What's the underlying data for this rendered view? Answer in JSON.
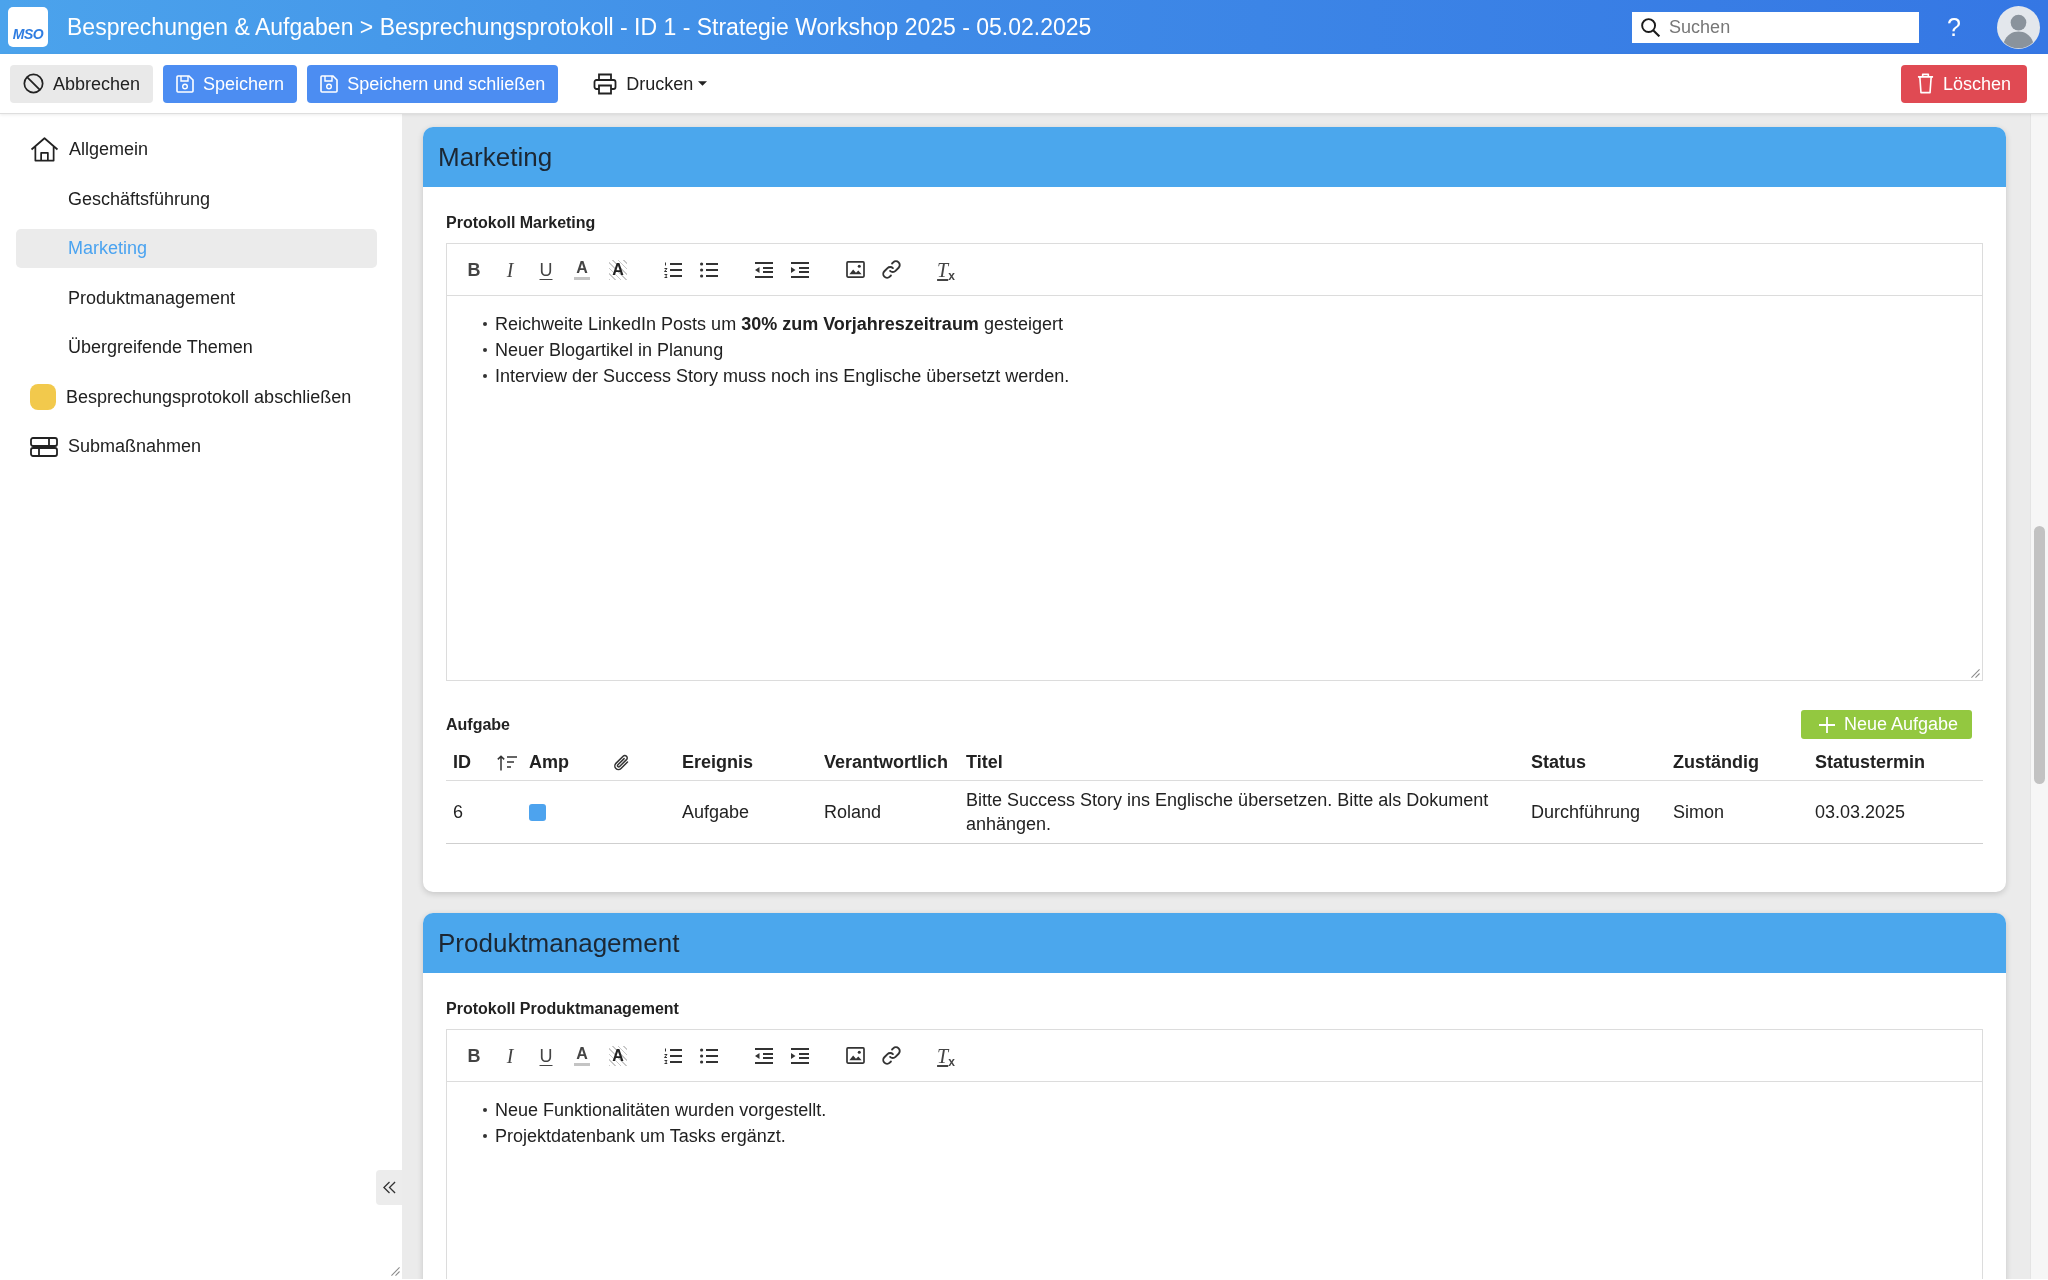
{
  "topbar": {
    "logo": "MSO",
    "title": "Besprechungen & Aufgaben > Besprechungsprotokoll - ID 1 - Strategie Workshop 2025 - 05.02.2025",
    "search": {
      "placeholder": "Suchen"
    },
    "help": "?"
  },
  "actions": [
    {
      "kind": "cancel",
      "label": "Abbrechen",
      "dropdown": false
    },
    {
      "kind": "save",
      "label": "Speichern",
      "dropdown": false
    },
    {
      "kind": "save_close",
      "label": "Speichern und schließen",
      "dropdown": false
    },
    {
      "kind": "print",
      "label": "Drucken",
      "dropdown": true
    }
  ],
  "delete_button": {
    "label": "Löschen"
  },
  "sidebar": {
    "items": [
      {
        "kind": "home",
        "label": "Allgemein",
        "selected": false
      },
      {
        "kind": "section",
        "label": "Geschäftsführung",
        "selected": false
      },
      {
        "kind": "section",
        "label": "Marketing",
        "selected": true
      },
      {
        "kind": "section",
        "label": "Produktmanagement",
        "selected": false
      },
      {
        "kind": "section",
        "label": "Übergreifende Themen",
        "selected": false
      },
      {
        "kind": "status",
        "label": "Besprechungsprotokoll abschließen",
        "color": "#f2c94c",
        "selected": false
      },
      {
        "kind": "table",
        "label": "Submaßnahmen",
        "selected": false
      }
    ]
  },
  "sections": [
    {
      "title": "Marketing",
      "editor": {
        "label": "Protokoll Marketing",
        "toolbar": [
          [
            {
              "kind": "bold",
              "glyph": "B"
            },
            {
              "kind": "italic",
              "glyph": "I"
            },
            {
              "kind": "underline",
              "glyph": "U"
            },
            {
              "kind": "font_color",
              "glyph": "A"
            },
            {
              "kind": "highlight",
              "glyph": "A"
            }
          ],
          [
            {
              "kind": "ordered_list"
            },
            {
              "kind": "bullet_list"
            }
          ],
          [
            {
              "kind": "outdent"
            },
            {
              "kind": "indent"
            }
          ],
          [
            {
              "kind": "image"
            },
            {
              "kind": "link"
            }
          ],
          [
            {
              "kind": "clear_format",
              "glyph": "T$_{x}$"
            }
          ]
        ],
        "lines": [
          "Reichweite LinkedIn Posts um **30% zum Vorjahreszeitraum** gesteigert",
          "Neuer Blogartikel in Planung",
          "Interview der Success Story muss noch ins Englische übersetzt werden."
        ]
      },
      "tasks": {
        "label": "Aufgabe",
        "new_button": "Neue Aufgabe",
        "columns": [
          {
            "kind": "text",
            "label": "ID"
          },
          {
            "kind": "sort"
          },
          {
            "kind": "text",
            "label": "Amp"
          },
          {
            "kind": "attachment"
          },
          {
            "kind": "text",
            "label": "Ereignis"
          },
          {
            "kind": "text",
            "label": "Verantwortlich"
          },
          {
            "kind": "text",
            "label": "Titel"
          },
          {
            "kind": "text",
            "label": "Status"
          },
          {
            "kind": "text",
            "label": "Zuständig"
          },
          {
            "kind": "text",
            "label": "Statustermin"
          }
        ],
        "rows": [
          {
            "id": "6",
            "amp": {
              "color": "#4da3ee"
            },
            "event": "Aufgabe",
            "responsible": "Roland",
            "title": "Bitte Success Story ins Englische übersetzen. Bitte als Dokument anhängen.",
            "status": "Durchführung",
            "assignee": "Simon",
            "status_date": "03.03.2025"
          }
        ]
      }
    },
    {
      "title": "Produktmanagement",
      "editor": {
        "label": "Protokoll Produktmanagement",
        "toolbar": [
          [
            {
              "kind": "bold",
              "glyph": "B"
            },
            {
              "kind": "italic",
              "glyph": "I"
            },
            {
              "kind": "underline",
              "glyph": "U"
            },
            {
              "kind": "font_color",
              "glyph": "A"
            },
            {
              "kind": "highlight",
              "glyph": "A"
            }
          ],
          [
            {
              "kind": "ordered_list"
            },
            {
              "kind": "bullet_list"
            }
          ],
          [
            {
              "kind": "outdent"
            },
            {
              "kind": "indent"
            }
          ],
          [
            {
              "kind": "image"
            },
            {
              "kind": "link"
            }
          ],
          [
            {
              "kind": "clear_format",
              "glyph": "T$_{x}$"
            }
          ]
        ],
        "lines": [
          "Neue Funktionalitäten wurden vorgestellt.",
          "Projektdatenbank um Tasks ergänzt."
        ]
      }
    }
  ]
}
